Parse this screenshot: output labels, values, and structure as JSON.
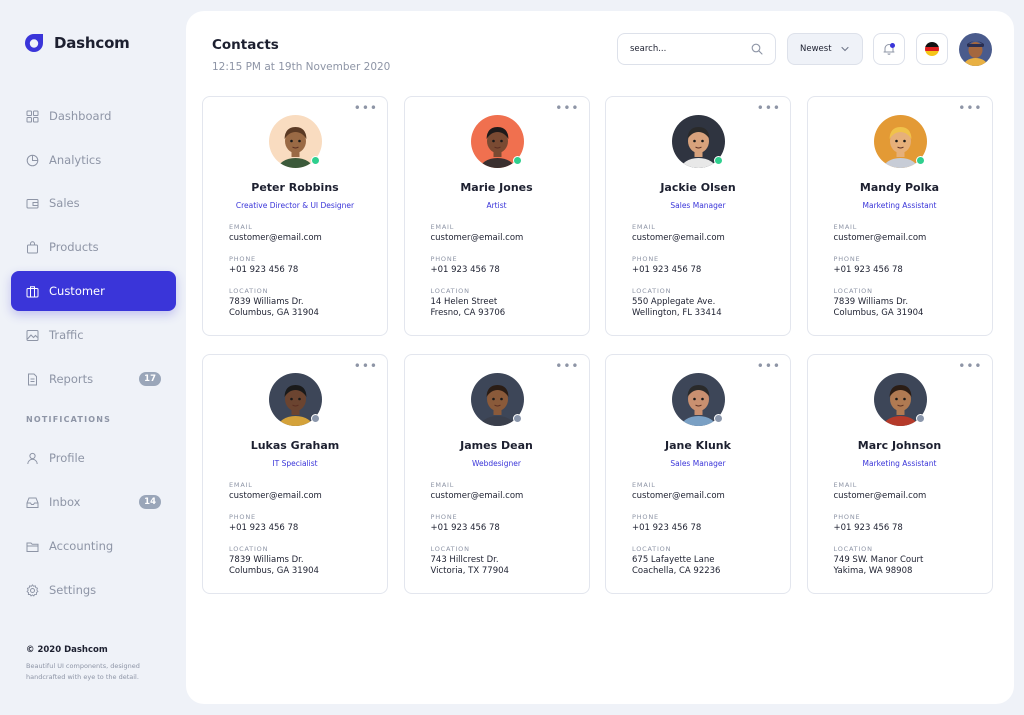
{
  "brand": {
    "name": "Dashcom",
    "color": "#3a35d9"
  },
  "nav": [
    {
      "label": "Dashboard",
      "icon": "grid-icon"
    },
    {
      "label": "Analytics",
      "icon": "pie-chart-icon"
    },
    {
      "label": "Sales",
      "icon": "wallet-icon"
    },
    {
      "label": "Products",
      "icon": "bag-icon"
    },
    {
      "label": "Customer",
      "icon": "briefcase-icon",
      "active": true
    },
    {
      "label": "Traffic",
      "icon": "image-icon"
    },
    {
      "label": "Reports",
      "icon": "document-icon",
      "badge": "17"
    }
  ],
  "notifications_label": "NOTIFICATIONS",
  "nav2": [
    {
      "label": "Profile",
      "icon": "user-icon"
    },
    {
      "label": "Inbox",
      "icon": "inbox-icon",
      "badge": "14"
    },
    {
      "label": "Accounting",
      "icon": "folder-icon"
    },
    {
      "label": "Settings",
      "icon": "gear-icon"
    }
  ],
  "footer": {
    "copyright": "© 2020 Dashcom",
    "description": "Beautiful UI components, designed handcrafted with eye to the detail."
  },
  "header": {
    "title": "Contacts",
    "subtitle": "12:15 PM at 19th November 2020",
    "search_placeholder": "search...",
    "sort": "Newest"
  },
  "labels": {
    "email": "EMAIL",
    "phone": "PHONE",
    "location": "LOCATION"
  },
  "contacts": [
    {
      "name": "Peter Robbins",
      "role": "Creative Director & UI Designer",
      "email": "customer@email.com",
      "phone": "+01 923 456 78",
      "loc1": "7839 Williams Dr.",
      "loc2": "Columbus, GA 31904",
      "online": true,
      "bg": "#f9dcc0"
    },
    {
      "name": "Marie Jones",
      "role": "Artist",
      "email": "customer@email.com",
      "phone": "+01 923 456 78",
      "loc1": "14 Helen Street",
      "loc2": "Fresno, CA 93706",
      "online": true,
      "bg": "#f0704f"
    },
    {
      "name": "Jackie Olsen",
      "role": "Sales Manager",
      "email": "customer@email.com",
      "phone": "+01 923 456 78",
      "loc1": "550 Applegate Ave.",
      "loc2": "Wellington, FL 33414",
      "online": true,
      "bg": "#2f3440"
    },
    {
      "name": "Mandy Polka",
      "role": "Marketing Assistant",
      "email": "customer@email.com",
      "phone": "+01 923 456 78",
      "loc1": "7839 Williams Dr.",
      "loc2": "Columbus, GA 31904",
      "online": true,
      "bg": "#e39a35"
    },
    {
      "name": "Lukas Graham",
      "role": "IT Specialist",
      "email": "customer@email.com",
      "phone": "+01 923 456 78",
      "loc1": "7839 Williams Dr.",
      "loc2": "Columbus, GA 31904",
      "online": false,
      "bg": "#3d4658"
    },
    {
      "name": "James Dean",
      "role": "Webdesigner",
      "email": "customer@email.com",
      "phone": "+01 923 456 78",
      "loc1": "743 Hillcrest Dr.",
      "loc2": "Victoria, TX 77904",
      "online": false,
      "bg": "#3d4658"
    },
    {
      "name": "Jane Klunk",
      "role": "Sales Manager",
      "email": "customer@email.com",
      "phone": "+01 923 456 78",
      "loc1": "675 Lafayette Lane",
      "loc2": "Coachella, CA 92236",
      "online": false,
      "bg": "#3d4658"
    },
    {
      "name": "Marc Johnson",
      "role": "Marketing Assistant",
      "email": "customer@email.com",
      "phone": "+01 923 456 78",
      "loc1": "749 SW. Manor Court",
      "loc2": "Yakima, WA 98908",
      "online": false,
      "bg": "#3d4658"
    }
  ],
  "colors": {
    "online": "#2fcf8e",
    "offline": "#8a96ab",
    "accent": "#3a35d9"
  }
}
